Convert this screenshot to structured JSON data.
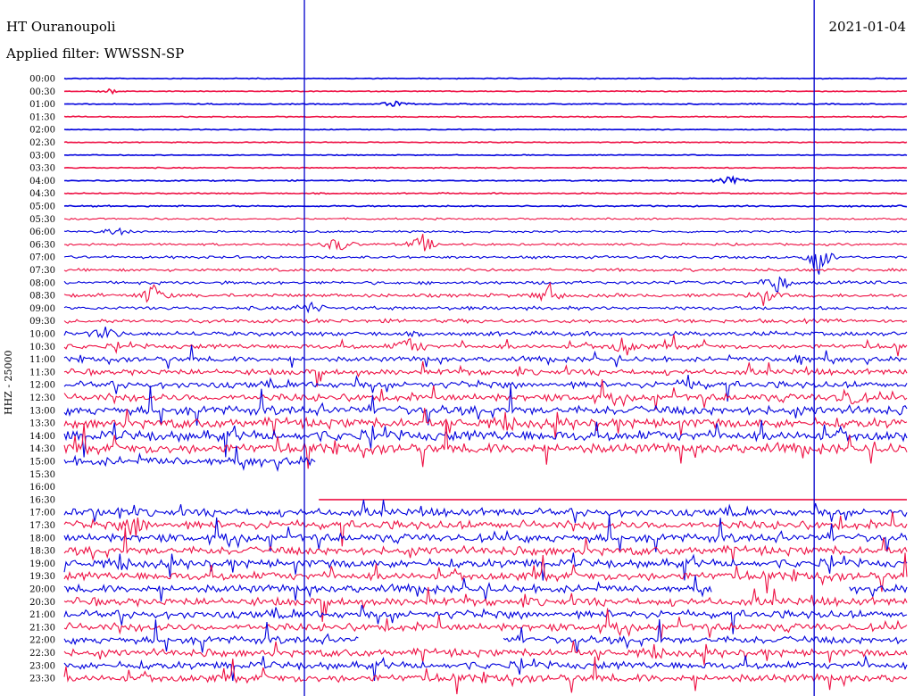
{
  "header": {
    "station": "HT Ouranoupoli",
    "filter": "Applied filter: WWSSN-SP",
    "date": "2021-01-04",
    "channel": "HHZ - 25000"
  },
  "colors": {
    "even_row": "#0000dd",
    "odd_row": "#ee1144",
    "marker": "#0000cc",
    "background": "#ffffff"
  },
  "chart_data": {
    "type": "line",
    "ylabel": "HHZ - 25000",
    "time_labels": [
      "00:00",
      "00:30",
      "01:00",
      "01:30",
      "02:00",
      "02:30",
      "03:00",
      "03:30",
      "04:00",
      "04:30",
      "05:00",
      "05:30",
      "06:00",
      "06:30",
      "07:00",
      "07:30",
      "08:00",
      "08:30",
      "09:00",
      "09:30",
      "10:00",
      "10:30",
      "11:00",
      "11:30",
      "12:00",
      "12:30",
      "13:00",
      "13:30",
      "14:00",
      "14:30",
      "15:00",
      "15:30",
      "16:00",
      "16:30",
      "17:00",
      "17:30",
      "18:00",
      "18:30",
      "19:00",
      "19:30",
      "20:00",
      "20:30",
      "21:00",
      "21:30",
      "22:00",
      "22:30",
      "23:00",
      "23:30"
    ],
    "noise_level": [
      0.3,
      0.3,
      0.35,
      0.35,
      0.3,
      0.3,
      0.3,
      0.35,
      0.4,
      0.4,
      0.5,
      0.6,
      0.7,
      0.8,
      0.9,
      1.0,
      1.1,
      1.2,
      1.2,
      1.3,
      1.5,
      1.6,
      1.7,
      1.9,
      2.2,
      2.5,
      3.0,
      3.2,
      3.5,
      3.3,
      3.0,
      0,
      0,
      0,
      2.5,
      2.8,
      2.8,
      2.8,
      2.8,
      2.8,
      2.6,
      2.6,
      2.6,
      2.6,
      2.5,
      2.5,
      2.5,
      2.6
    ],
    "gaps": [
      {
        "row": 30,
        "from": 0.3,
        "to": 1.0
      },
      {
        "row": 31,
        "from": 0.0,
        "to": 1.0
      },
      {
        "row": 32,
        "from": 0.0,
        "to": 1.0
      },
      {
        "row": 33,
        "from": 0.0,
        "to": 0.3
      },
      {
        "row": 40,
        "from": 0.77,
        "to": 0.93
      },
      {
        "row": 44,
        "from": 0.35,
        "to": 0.52
      }
    ],
    "events": [
      {
        "row": 1,
        "pos": 0.055,
        "amp": 3
      },
      {
        "row": 2,
        "pos": 0.39,
        "amp": 4
      },
      {
        "row": 8,
        "pos": 0.79,
        "amp": 5
      },
      {
        "row": 12,
        "pos": 0.06,
        "amp": 6
      },
      {
        "row": 13,
        "pos": 0.325,
        "amp": 10
      },
      {
        "row": 13,
        "pos": 0.425,
        "amp": 12
      },
      {
        "row": 14,
        "pos": 0.895,
        "amp": 22
      },
      {
        "row": 16,
        "pos": 0.845,
        "amp": 14
      },
      {
        "row": 17,
        "pos": 0.105,
        "amp": 14
      },
      {
        "row": 17,
        "pos": 0.575,
        "amp": 14
      },
      {
        "row": 17,
        "pos": 0.83,
        "amp": 10
      },
      {
        "row": 18,
        "pos": 0.29,
        "amp": 8
      },
      {
        "row": 20,
        "pos": 0.05,
        "amp": 8
      },
      {
        "row": 21,
        "pos": 0.41,
        "amp": 12
      },
      {
        "row": 21,
        "pos": 0.665,
        "amp": 12
      },
      {
        "row": 22,
        "pos": 0.87,
        "amp": 8
      },
      {
        "row": 24,
        "pos": 0.74,
        "amp": 10
      },
      {
        "row": 25,
        "pos": 0.93,
        "amp": 12
      },
      {
        "row": 35,
        "pos": 0.085,
        "amp": 12
      }
    ],
    "markers": [
      0.285,
      0.89
    ]
  }
}
